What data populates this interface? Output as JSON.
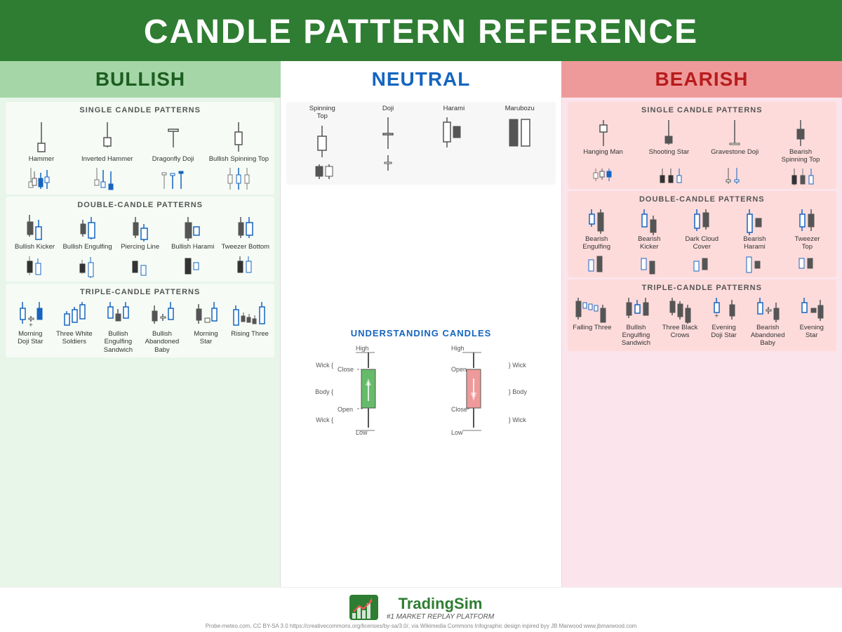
{
  "header": {
    "title": "CANDLE PATTERN REFERENCE"
  },
  "categories": {
    "bullish": "BULLISH",
    "neutral": "NEUTRAL",
    "bearish": "BEARISH"
  },
  "bullish": {
    "single_header": "SINGLE CANDLE PATTERNS",
    "single_patterns": [
      "Hammer",
      "Inverted Hammer",
      "Dragonfly Doji",
      "Bullish Spinning Top"
    ],
    "double_header": "DOUBLE-CANDLE PATTERNS",
    "double_patterns": [
      "Bullish Kicker",
      "Bullish Engulfing",
      "Piercing Line",
      "Bullish Harami",
      "Tweezer Bottom"
    ],
    "triple_header": "TRIPLE-CANDLE PATTERNS",
    "triple_patterns": [
      "Morning Doji Star",
      "Three White Soldiers",
      "Bullish Engulfing Sandwich",
      "Bullish Abandoned Baby",
      "Morning Star",
      "Rising Three"
    ]
  },
  "neutral": {
    "single_patterns": [
      "Spinning Top",
      "Doji",
      "Harami",
      "Marubozu"
    ],
    "understanding_header": "UNDERSTANDING CANDLES",
    "labels": {
      "high": "High",
      "low": "Low",
      "open": "Open",
      "close": "Close",
      "wick_top": "Wick",
      "wick_bottom": "Wick",
      "body": "Body"
    }
  },
  "bearish": {
    "single_header": "SINGLE CANDLE PATTERNS",
    "single_patterns": [
      "Hanging Man",
      "Shooting Star",
      "Gravestone Doji",
      "Bearish Spinning Top"
    ],
    "double_header": "DOUBLE-CANDLE PATTERNS",
    "double_patterns": [
      "Bearish Engulfing",
      "Bearish Kicker",
      "Dark Cloud Cover",
      "Bearish Harami",
      "Tweezer Top"
    ],
    "triple_header": "TRIPLE-CANDLE PATTERNS",
    "triple_patterns": [
      "Falling Three",
      "Bullish Engulfing Sandwich",
      "Three Black Crows",
      "Evening Doji Star",
      "Bearish Abandoned Baby",
      "Evening Star"
    ]
  },
  "footer": {
    "logo": "TradingSim",
    "tagline": "#1 MARKET REPLAY PLATFORM",
    "credits": "Probe-meteo.com, CC BY-SA 3.0 https://creativecommons.org/licenses/by-sa/3.0/, via Wikimedia Commons     Infographic design inpired byy JB Marwood www.jbmarwood.com"
  }
}
